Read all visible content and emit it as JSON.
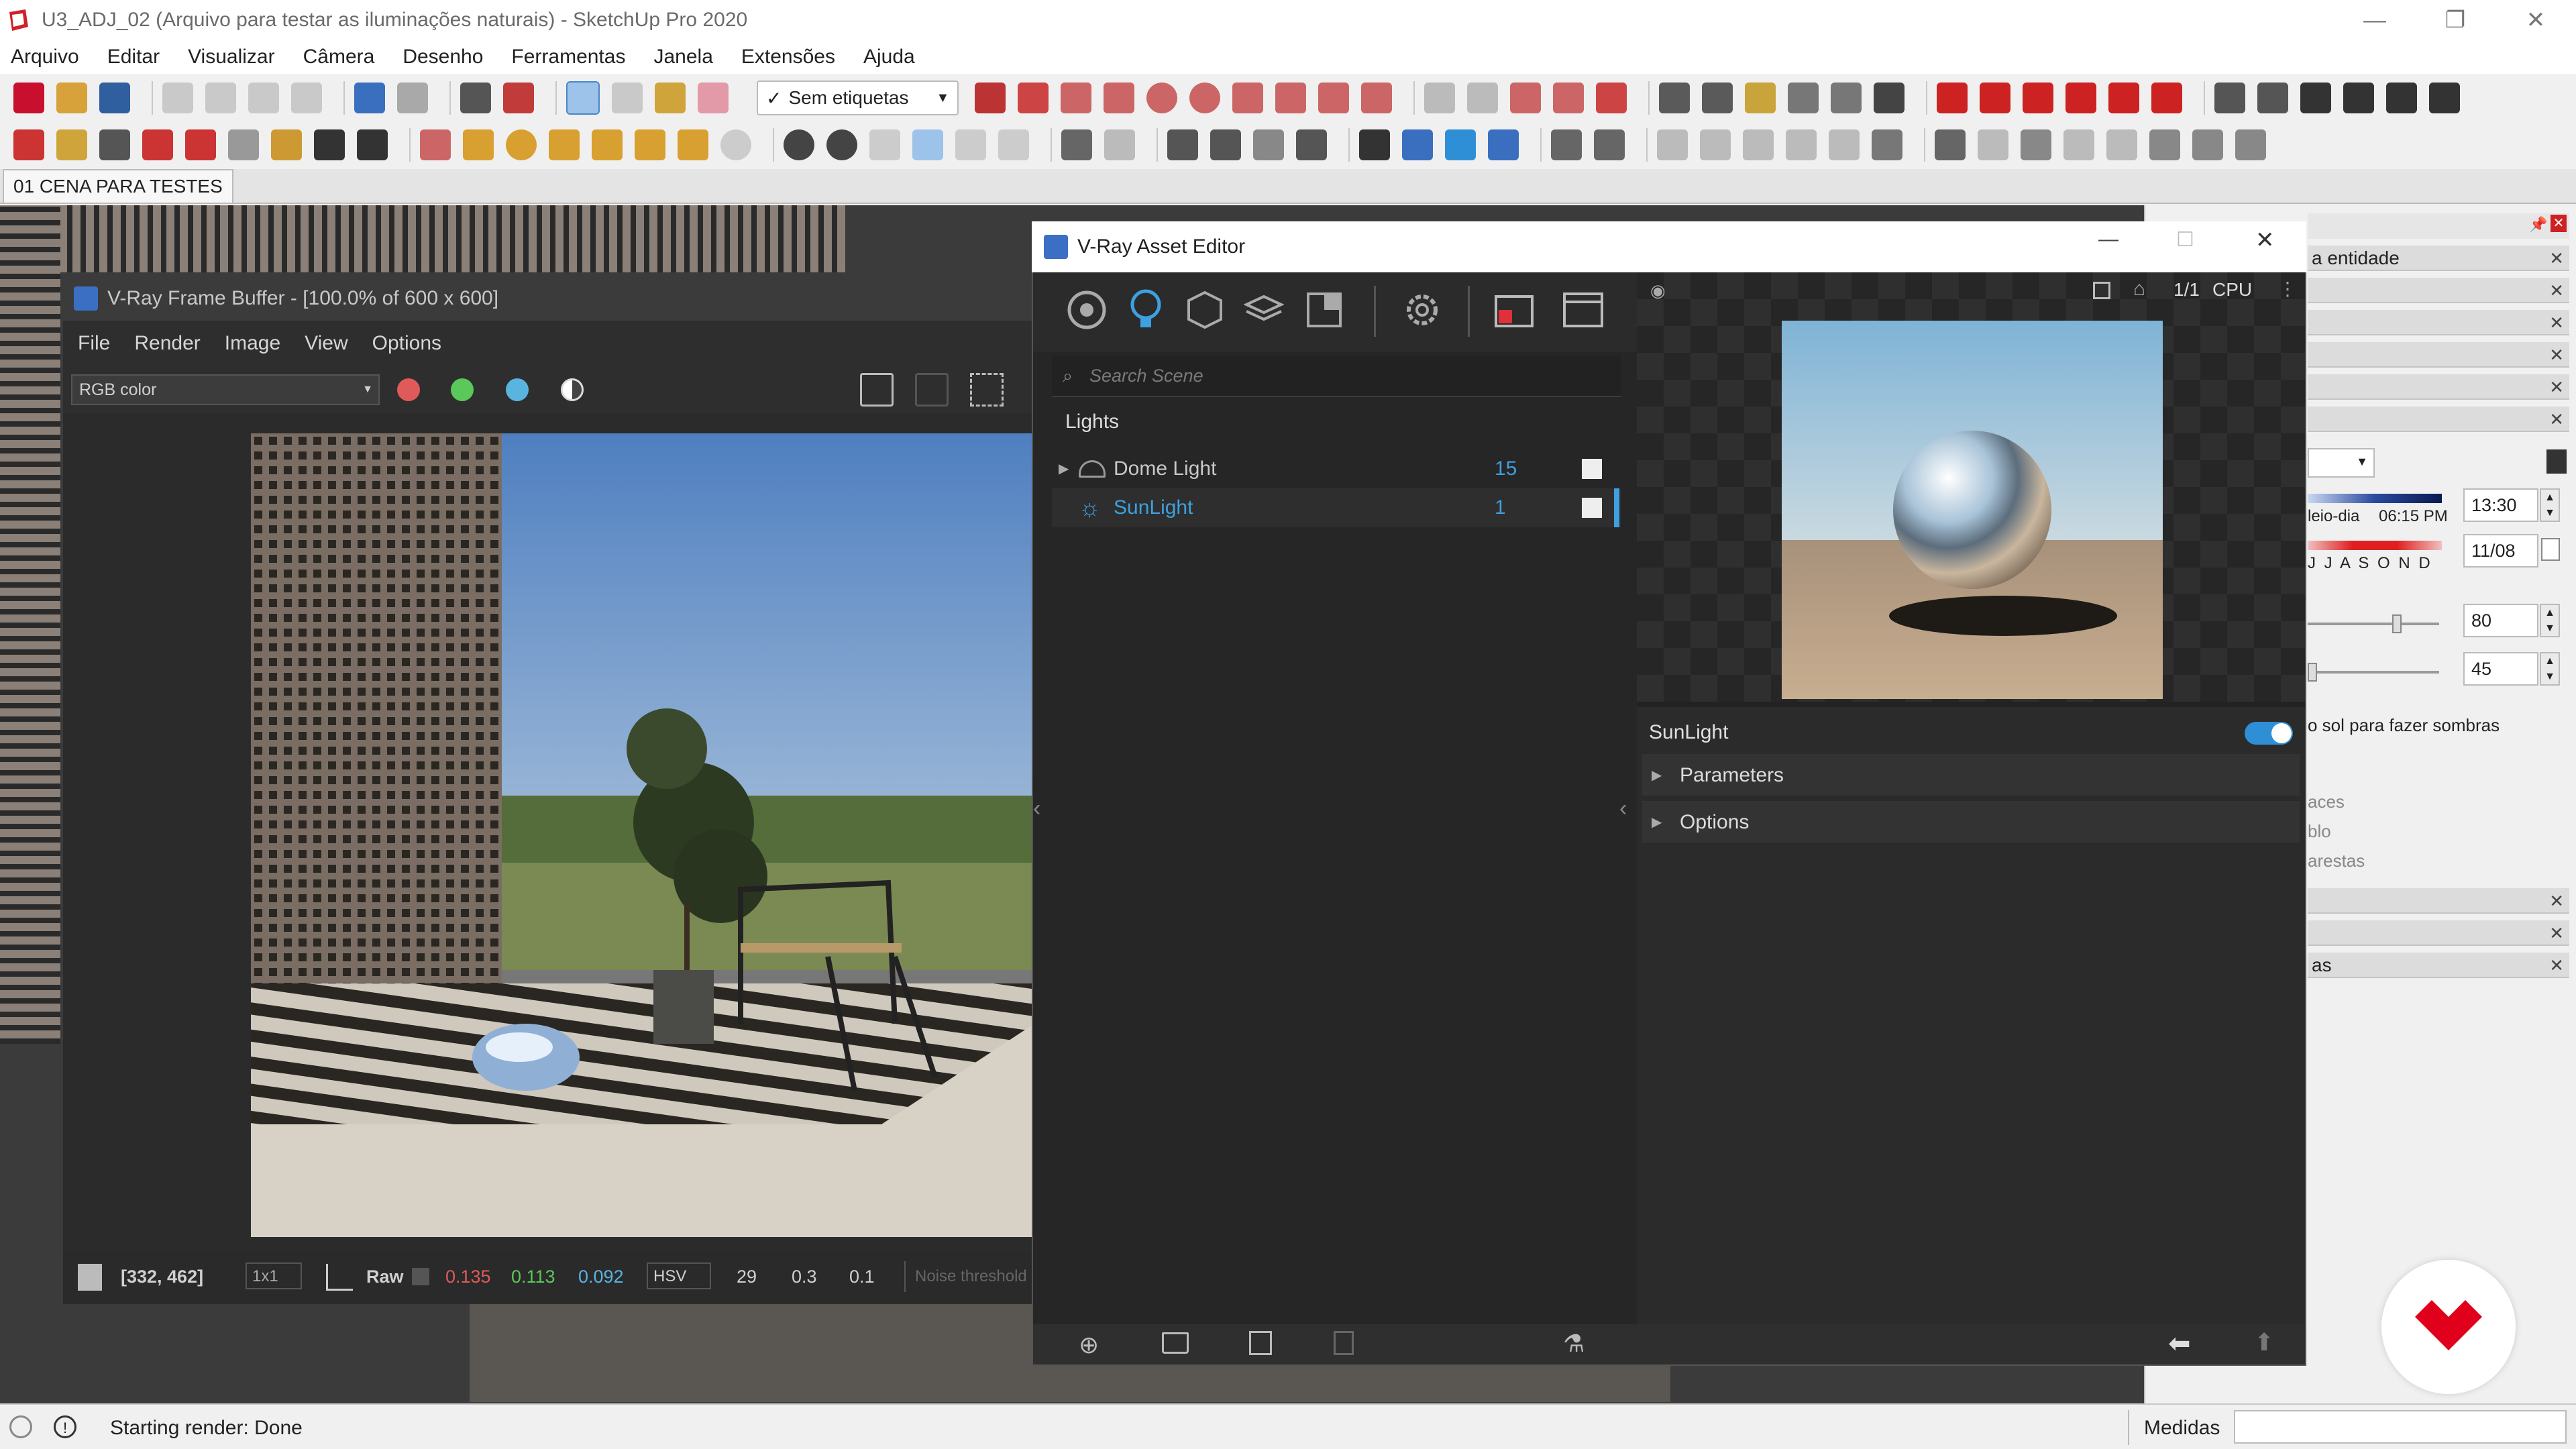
{
  "window": {
    "title": "U3_ADJ_02 (Arquivo para testar as iluminações naturais) - SketchUp Pro 2020",
    "minimize": "—",
    "maximize": "❐",
    "close": "✕"
  },
  "menu": [
    "Arquivo",
    "Editar",
    "Visualizar",
    "Câmera",
    "Desenho",
    "Ferramentas",
    "Janela",
    "Extensões",
    "Ajuda"
  ],
  "toolbar": {
    "tags_label": "Sem etiquetas"
  },
  "scene_tab": "01 CENA PARA TESTES",
  "frame_buffer": {
    "title": "V-Ray Frame Buffer - [100.0% of 600 x 600]",
    "menu": [
      "File",
      "Render",
      "Image",
      "View",
      "Options"
    ],
    "channel": "RGB color",
    "status": {
      "coords": "[332, 462]",
      "zoom": "1x1",
      "mode": "Raw",
      "r": "0.135",
      "g": "0.113",
      "b": "0.092",
      "colorspace": "HSV",
      "h": "29",
      "s": "0.3",
      "v": "0.1",
      "noise": "Noise threshold"
    }
  },
  "asset_editor": {
    "title": "V-Ray Asset Editor",
    "search_placeholder": "Search Scene",
    "section": "Lights",
    "lights": [
      {
        "name": "Dome Light",
        "count": "15"
      },
      {
        "name": "SunLight",
        "count": "1"
      }
    ],
    "preview_badge": "CPU",
    "preview_ratio": "1/1",
    "selected": "SunLight",
    "panels": [
      "Parameters",
      "Options"
    ]
  },
  "tray": {
    "entity": "a entidade",
    "time_label_1": "leio-dia",
    "time_label_2": "06:15 PM",
    "time": "13:30",
    "months": "J J A S O N D",
    "date": "11/08",
    "value_1": "80",
    "value_2": "45",
    "shadow_note": "o sol para fazer sombras",
    "item_1": "aces",
    "item_2": "blo",
    "item_3": "arestas",
    "item_4": "as"
  },
  "status_bar": {
    "message": "Starting render: Done",
    "measure_label": "Medidas"
  },
  "colors": {
    "accent": "#3da0e0",
    "logo": "#e0001b",
    "toggle": "#2f8fd6"
  }
}
